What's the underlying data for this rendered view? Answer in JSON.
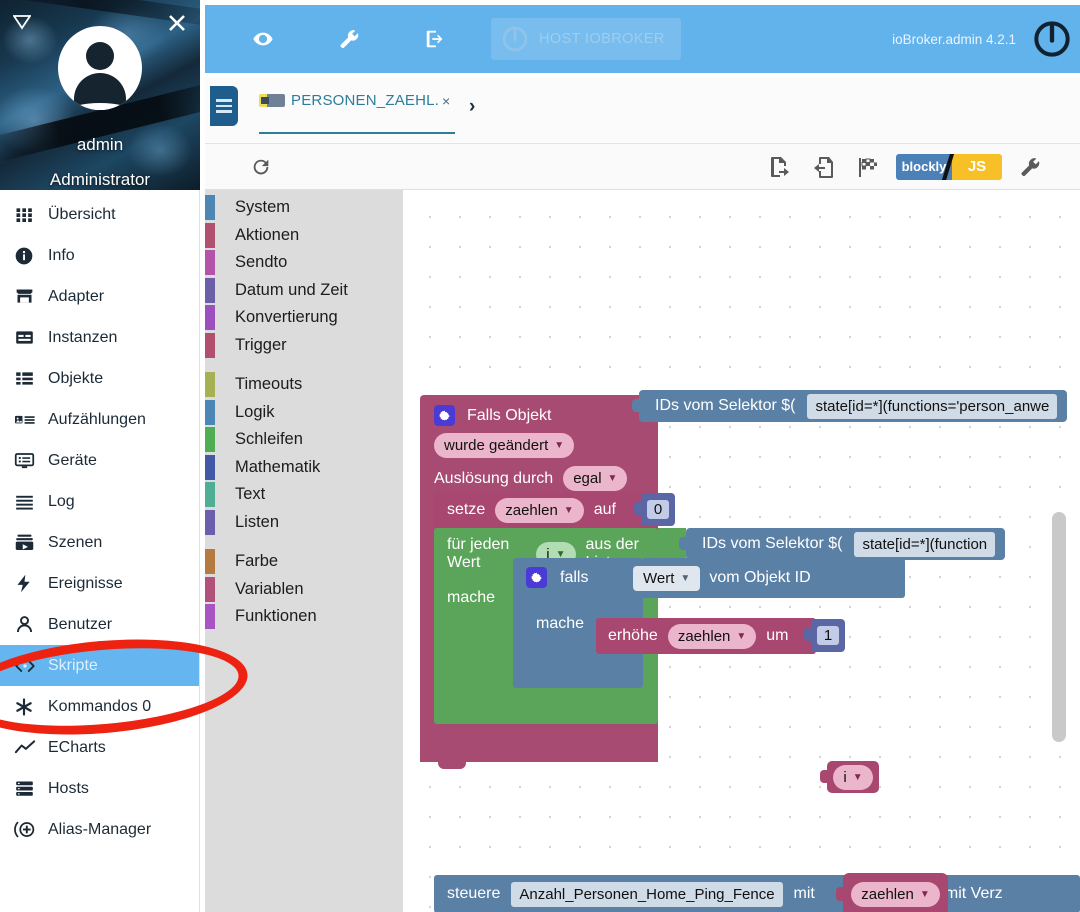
{
  "drawer": {
    "collapse_icon": "triangle-collapse-icon",
    "close_icon": "close-icon",
    "user_name": "admin",
    "user_role": "Administrator",
    "items": [
      {
        "label": "Übersicht",
        "icon": "grid-icon",
        "selected": false
      },
      {
        "label": "Info",
        "icon": "info-icon",
        "selected": false
      },
      {
        "label": "Adapter",
        "icon": "store-icon",
        "selected": false
      },
      {
        "label": "Instanzen",
        "icon": "instances-icon",
        "selected": false
      },
      {
        "label": "Objekte",
        "icon": "list-icon",
        "selected": false
      },
      {
        "label": "Aufzählungen",
        "icon": "enum-icon",
        "selected": false
      },
      {
        "label": "Geräte",
        "icon": "device-icon",
        "selected": false
      },
      {
        "label": "Log",
        "icon": "log-lines-icon",
        "selected": false
      },
      {
        "label": "Szenen",
        "icon": "scenes-icon",
        "selected": false
      },
      {
        "label": "Ereignisse",
        "icon": "bolt-icon",
        "selected": false
      },
      {
        "label": "Benutzer",
        "icon": "person-icon",
        "selected": false
      },
      {
        "label": "Skripte",
        "icon": "code-brackets-icon",
        "selected": true
      },
      {
        "label": "Kommandos 0",
        "icon": "asterisk-icon",
        "selected": false
      },
      {
        "label": "ECharts",
        "icon": "chart-line-icon",
        "selected": false
      },
      {
        "label": "Hosts",
        "icon": "server-icon",
        "selected": false
      },
      {
        "label": "Alias-Manager",
        "icon": "alias-plus-icon",
        "selected": false
      }
    ],
    "annotation": {
      "shape": "ellipse",
      "color": "#ee2211",
      "targets": "Skripte / Kommandos 0"
    }
  },
  "appbar": {
    "background": "#62b3ec",
    "icons": [
      {
        "name": "eye-icon",
        "glyph": "eye"
      },
      {
        "name": "wrench-icon",
        "glyph": "wrench"
      },
      {
        "name": "logout-icon",
        "glyph": "logout"
      }
    ],
    "host_button": {
      "label": "HOST IOBROKER",
      "icon": "iobroker-logo-icon"
    },
    "version": "ioBroker.admin 4.2.1",
    "brand_logo": "iobroker-logo-icon"
  },
  "tabsrow": {
    "menu_button": "hamburger-menu-icon",
    "tab": {
      "icon": "blockly-script-icon",
      "label": "PERSONEN_ZAEHL.",
      "close": "×"
    },
    "chevron": "›"
  },
  "editor_toolbar": {
    "reload_icon": "reload-icon",
    "buttons": [
      {
        "name": "export-blocks-icon"
      },
      {
        "name": "import-blocks-icon"
      },
      {
        "name": "checkered-flag-icon"
      }
    ],
    "toggle": {
      "left": "blockly",
      "right": "JS"
    },
    "settings_icon": "wrench-icon"
  },
  "toolbox": {
    "categories": [
      {
        "label": "System",
        "color": "#4b86b4"
      },
      {
        "label": "Aktionen",
        "color": "#b25070"
      },
      {
        "label": "Sendto",
        "color": "#b454a8"
      },
      {
        "label": "Datum und Zeit",
        "color": "#6b5fa8"
      },
      {
        "label": "Konvertierung",
        "color": "#9c4fbf"
      },
      {
        "label": "Trigger",
        "color": "#b24f6d"
      },
      {
        "label": "Timeouts",
        "color": "#a8b054"
      },
      {
        "label": "Logik",
        "color": "#4b86b4"
      },
      {
        "label": "Schleifen",
        "color": "#4fad54"
      },
      {
        "label": "Mathematik",
        "color": "#4359a8"
      },
      {
        "label": "Text",
        "color": "#4fae95"
      },
      {
        "label": "Listen",
        "color": "#6b5fad"
      },
      {
        "label": "Farbe",
        "color": "#b57a3f"
      },
      {
        "label": "Variablen",
        "color": "#b2517a"
      },
      {
        "label": "Funktionen",
        "color": "#a855c4"
      }
    ],
    "gaps_after": [
      6,
      12
    ]
  },
  "workspace": {
    "blocks": {
      "trigger_title": "Falls Objekt",
      "trigger_mode": "wurde geändert",
      "trigger_source_label": "Auslösung durch",
      "trigger_source_value": "egal",
      "selector_label_1": "IDs vom Selektor $(",
      "selector_value_1": "state[id=*](functions='person_anwe",
      "set_label": "setze",
      "set_var": "zaehlen",
      "set_to": "auf",
      "set_value": "0",
      "foreach_label": "für jeden Wert",
      "foreach_var": "i",
      "foreach_from": "aus der Liste",
      "selector_label_2": "IDs vom Selektor $(",
      "selector_value_2": "state[id=*](function",
      "do_label_1": "mache",
      "if_label": "falls",
      "value_dd": "Wert",
      "from_object_id": "vom Objekt ID",
      "object_id_var": "i",
      "do_label_2": "mache",
      "increment_label": "erhöhe",
      "increment_var": "zaehlen",
      "increment_by": "um",
      "increment_value": "1",
      "control_label": "steuere",
      "control_target": "Anzahl_Personen_Home_Ping_Fence",
      "control_with": "mit",
      "control_value": "zaehlen",
      "control_delay": "mit Verz"
    },
    "scrollbar": "vertical-scrollbar"
  }
}
